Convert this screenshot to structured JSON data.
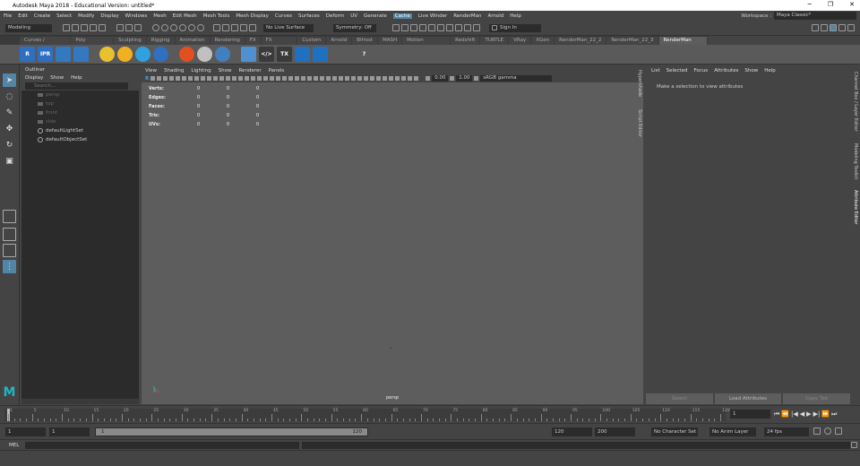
{
  "window": {
    "title": "Autodesk Maya 2018 - Educational Version: untitled*",
    "minimize": "─",
    "maximize": "❐",
    "close": "✕"
  },
  "menubar": [
    "File",
    "Edit",
    "Create",
    "Select",
    "Modify",
    "Display",
    "Windows",
    "Mesh",
    "Edit Mesh",
    "Mesh Tools",
    "Mesh Display",
    "Curves",
    "Surfaces",
    "Deform",
    "UV",
    "Generate",
    "Cache",
    "Live Winder",
    "RenderMan",
    "Arnold",
    "Help"
  ],
  "menubar_active_index": 16,
  "workspace": {
    "label": "Workspace :",
    "value": "Maya Classic*"
  },
  "statusline": {
    "mode": "Modeling",
    "live_surface": "No Live Surface",
    "symmetry": "Symmetry: Off",
    "sign_in": "Sign In"
  },
  "shelf_tabs": [
    "Curves / Surfaces",
    "Poly Modeling",
    "Sculpting",
    "Rigging",
    "Animation",
    "Rendering",
    "FX",
    "FX Caching",
    "Custom",
    "Arnold",
    "Bifrost",
    "MASH",
    "Motion Graphics",
    "Redshift",
    "TURTLE",
    "VRay",
    "XGen",
    "RenderMan_22_2",
    "RenderMan_22_3",
    "RenderMan 22.0"
  ],
  "shelf_active_index": 19,
  "shelf_buttons": [
    {
      "name": "renderman-r-icon",
      "label": "R",
      "color": "#2f6fc2"
    },
    {
      "name": "renderman-ipr-icon",
      "label": "IPR",
      "color": "#2f6fc2"
    },
    {
      "name": "render-preview-icon",
      "label": "",
      "color": "#3478c0"
    },
    {
      "name": "clapper-icon",
      "label": "",
      "color": "#3478c0"
    },
    {
      "name": "light-sun-icon",
      "label": "",
      "color": "#e8c030"
    },
    {
      "name": "light-sun2-icon",
      "label": "",
      "color": "#f0b020"
    },
    {
      "name": "light-dome-icon",
      "label": "",
      "color": "#30a0e0"
    },
    {
      "name": "light-ring-icon",
      "label": "",
      "color": "#3070c0"
    },
    {
      "name": "material-orange-icon",
      "label": "",
      "color": "#e05020"
    },
    {
      "name": "material-white-icon",
      "label": "",
      "color": "#c0c0c0"
    },
    {
      "name": "material-blue-icon",
      "label": "",
      "color": "#4080c0"
    },
    {
      "name": "cube-icon",
      "label": "",
      "color": "#5090d0"
    },
    {
      "name": "code-icon",
      "label": "</>",
      "color": "#3a3a3a"
    },
    {
      "name": "tx-icon",
      "label": "TX",
      "color": "#3a3a3a"
    },
    {
      "name": "moon-icon",
      "label": "",
      "color": "#2070c0"
    },
    {
      "name": "waveform-icon",
      "label": "",
      "color": "#2070c0"
    },
    {
      "name": "settings-icon",
      "label": "",
      "color": "#5a5a5a"
    },
    {
      "name": "help-icon",
      "label": "?",
      "color": "#5a5a5a"
    }
  ],
  "outliner": {
    "title": "Outliner",
    "menu": [
      "Display",
      "Show",
      "Help"
    ],
    "search_placeholder": "Search...",
    "items": [
      {
        "label": "persp",
        "dim": true,
        "icon": "camera-icon"
      },
      {
        "label": "top",
        "dim": true,
        "icon": "camera-icon"
      },
      {
        "label": "front",
        "dim": true,
        "icon": "camera-icon"
      },
      {
        "label": "side",
        "dim": true,
        "icon": "camera-icon"
      },
      {
        "label": "defaultLightSet",
        "dim": false,
        "icon": "set-icon"
      },
      {
        "label": "defaultObjectSet",
        "dim": false,
        "icon": "set-icon"
      }
    ]
  },
  "viewport": {
    "menu": [
      "View",
      "Shading",
      "Lighting",
      "Show",
      "Renderer",
      "Panels"
    ],
    "exposure": "0.00",
    "gamma": "1.00",
    "color_space": "sRGB gamma",
    "camera_label": "persp",
    "hud": [
      {
        "label": "Verts:",
        "v1": "0",
        "v2": "0",
        "v3": "0"
      },
      {
        "label": "Edges:",
        "v1": "0",
        "v2": "0",
        "v3": "0"
      },
      {
        "label": "Faces:",
        "v1": "0",
        "v2": "0",
        "v3": "0"
      },
      {
        "label": "Tris:",
        "v1": "0",
        "v2": "0",
        "v3": "0"
      },
      {
        "label": "UVs:",
        "v1": "0",
        "v2": "0",
        "v3": "0"
      }
    ]
  },
  "attribute_editor": {
    "menu": [
      "List",
      "Selected",
      "Focus",
      "Attributes",
      "Show",
      "Help"
    ],
    "message": "Make a selection to view attributes",
    "buttons": [
      "Select",
      "Load Attributes",
      "Copy Tab"
    ],
    "side_tabs_left": [
      "Hypershade",
      "Script Editor"
    ],
    "side_tabs_right": [
      "Channel Box / Layer Editor",
      "Modeling Toolkit",
      "Attribute Editor"
    ]
  },
  "timeline": {
    "ticks": [
      "1",
      "5",
      "10",
      "15",
      "20",
      "25",
      "30",
      "35",
      "40",
      "45",
      "50",
      "55",
      "60",
      "65",
      "70",
      "75",
      "80",
      "85",
      "90",
      "95",
      "100",
      "105",
      "110",
      "115",
      "120"
    ],
    "current_frame": "1",
    "playback_buttons": [
      "⏮",
      "⏪",
      "|◀",
      "◀",
      "▶",
      "▶|",
      "⏩",
      "⏭"
    ]
  },
  "range": {
    "start": "1",
    "anim_start": "1",
    "range_start": "1",
    "range_end": "120",
    "anim_end": "120",
    "end": "200",
    "character_set": "No Character Set",
    "anim_layer": "No Anim Layer",
    "fps": "24 fps"
  },
  "cmdline": {
    "label": "MEL"
  }
}
